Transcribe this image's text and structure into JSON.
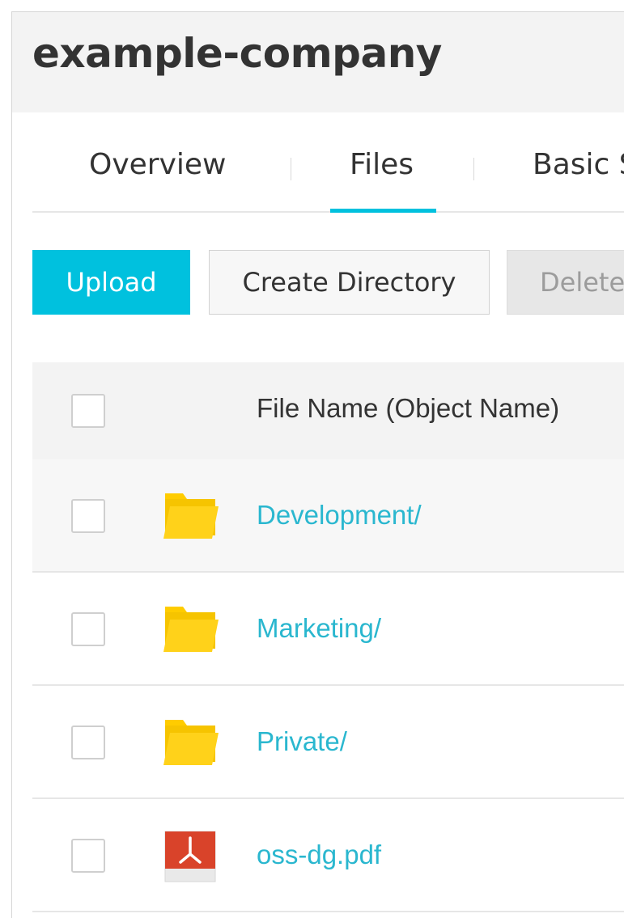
{
  "header": {
    "title": "example-company"
  },
  "tabs": [
    {
      "label": "Overview",
      "active": false
    },
    {
      "label": "Files",
      "active": true
    },
    {
      "label": "Basic S",
      "active": false
    }
  ],
  "toolbar": {
    "upload_label": "Upload",
    "create_directory_label": "Create Directory",
    "delete_label": "Delete"
  },
  "table": {
    "columns": {
      "name": "File Name (Object Name)"
    },
    "rows": [
      {
        "name": "Development/",
        "type": "folder",
        "icon": "folder-icon"
      },
      {
        "name": "Marketing/",
        "type": "folder",
        "icon": "folder-icon"
      },
      {
        "name": "Private/",
        "type": "folder",
        "icon": "folder-icon"
      },
      {
        "name": "oss-dg.pdf",
        "type": "pdf",
        "icon": "pdf-file-icon"
      }
    ]
  },
  "colors": {
    "accent": "#00c1de",
    "link": "#2ab7cf",
    "folder": "#ffcc00",
    "pdf": "#d9432a"
  }
}
